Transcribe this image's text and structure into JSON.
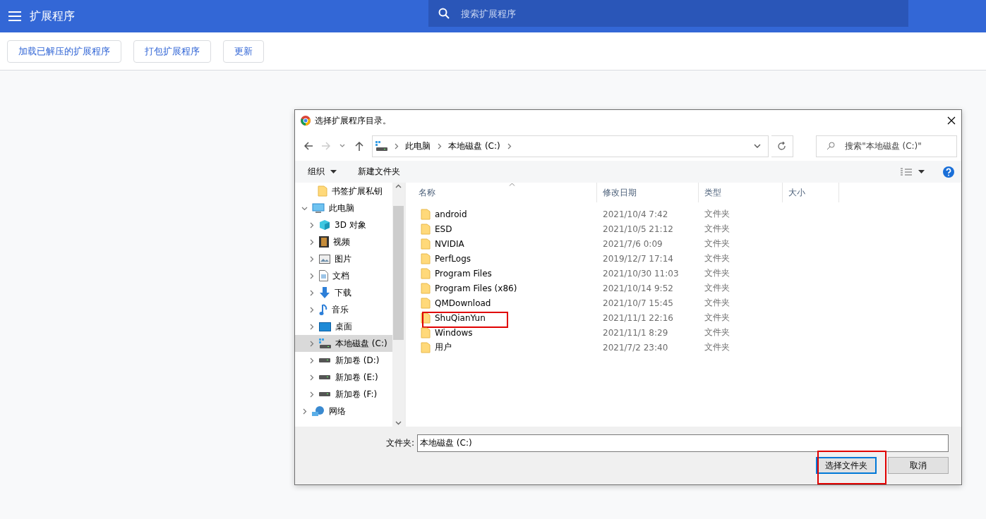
{
  "app_bar": {
    "title": "扩展程序",
    "search": {
      "placeholder": "搜索扩展程序"
    }
  },
  "toolbar": {
    "buttons": [
      "加载已解压的扩展程序",
      "打包扩展程序",
      "更新"
    ]
  },
  "dialog": {
    "title": "选择扩展程序目录。",
    "breadcrumbs": [
      "此电脑",
      "本地磁盘 (C:)"
    ],
    "search": {
      "placeholder": "搜索\"本地磁盘 (C:)\""
    },
    "commands": [
      "组织",
      "新建文件夹"
    ],
    "tree": [
      {
        "label": "书签扩展私钥",
        "kind": "folder",
        "selected": false
      },
      {
        "label": "此电脑",
        "kind": "pc",
        "expanded": true,
        "selected": false,
        "children": [
          {
            "label": "3D 对象",
            "kind": "cube",
            "expanded": false,
            "selected": false
          },
          {
            "label": "视频",
            "kind": "video",
            "expanded": false,
            "selected": false
          },
          {
            "label": "图片",
            "kind": "picture",
            "expanded": false,
            "selected": false
          },
          {
            "label": "文档",
            "kind": "document",
            "expanded": false,
            "selected": false
          },
          {
            "label": "下载",
            "kind": "download",
            "expanded": false,
            "selected": false
          },
          {
            "label": "音乐",
            "kind": "music",
            "expanded": false,
            "selected": false
          },
          {
            "label": "桌面",
            "kind": "desktop",
            "expanded": false,
            "selected": false
          },
          {
            "label": "本地磁盘 (C:)",
            "kind": "systemdrive",
            "expanded": false,
            "selected": true
          },
          {
            "label": "新加卷 (D:)",
            "kind": "drive",
            "expanded": false,
            "selected": false
          },
          {
            "label": "新加卷 (E:)",
            "kind": "drive",
            "expanded": false,
            "selected": false
          },
          {
            "label": "新加卷 (F:)",
            "kind": "drive",
            "expanded": false,
            "selected": false
          }
        ]
      },
      {
        "label": "网络",
        "kind": "network",
        "expanded": false,
        "selected": false
      }
    ],
    "columns": [
      "名称",
      "修改日期",
      "类型",
      "大小"
    ],
    "rows": [
      {
        "name": "android",
        "modified": "2021/10/4 7:42",
        "type": "文件夹",
        "highlighted": false
      },
      {
        "name": "ESD",
        "modified": "2021/10/5 21:12",
        "type": "文件夹",
        "highlighted": false
      },
      {
        "name": "NVIDIA",
        "modified": "2021/7/6 0:09",
        "type": "文件夹",
        "highlighted": false
      },
      {
        "name": "PerfLogs",
        "modified": "2019/12/7 17:14",
        "type": "文件夹",
        "highlighted": false
      },
      {
        "name": "Program Files",
        "modified": "2021/10/30 11:03",
        "type": "文件夹",
        "highlighted": false
      },
      {
        "name": "Program Files (x86)",
        "modified": "2021/10/14 9:52",
        "type": "文件夹",
        "highlighted": false
      },
      {
        "name": "QMDownload",
        "modified": "2021/10/7 15:45",
        "type": "文件夹",
        "highlighted": false
      },
      {
        "name": "ShuQianYun",
        "modified": "2021/11/1 22:16",
        "type": "文件夹",
        "highlighted": true
      },
      {
        "name": "Windows",
        "modified": "2021/11/1 8:29",
        "type": "文件夹",
        "highlighted": false
      },
      {
        "name": "用户",
        "modified": "2021/7/2 23:40",
        "type": "文件夹",
        "highlighted": false
      }
    ],
    "folder_field": {
      "label": "文件夹:",
      "value": "本地磁盘 (C:)"
    },
    "buttons": [
      {
        "label": "选择文件夹",
        "kind": "primary",
        "highlighted": true
      },
      {
        "label": "取消",
        "kind": "secondary",
        "highlighted": false
      }
    ]
  }
}
